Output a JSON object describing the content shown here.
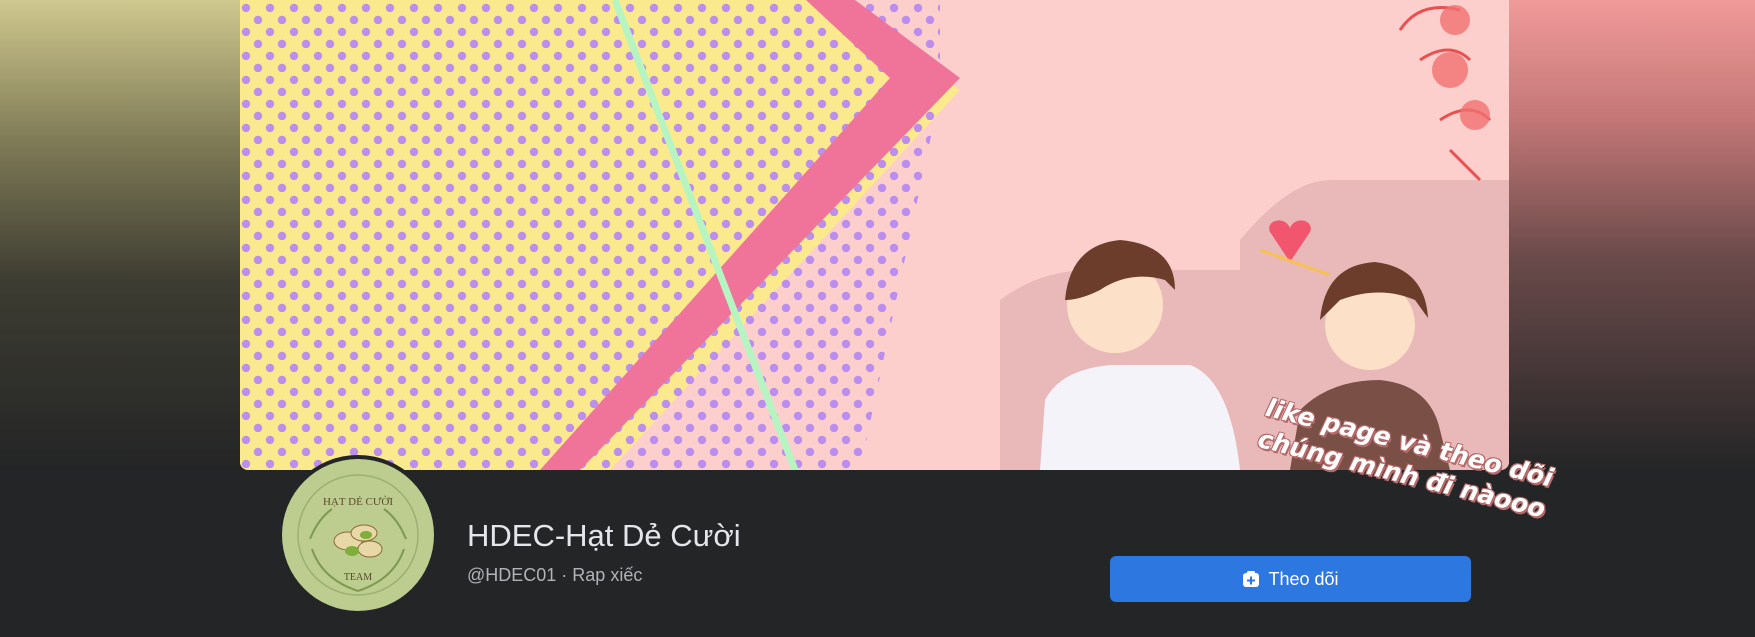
{
  "cover": {
    "caption_line1": "like page và theo dõi",
    "caption_line2": "chúng mình đi nàooo"
  },
  "avatar": {
    "text_top": "HẠT DẺ CƯỜI",
    "text_bottom": "TEAM"
  },
  "page": {
    "name": "HDEC-Hạt Dẻ Cười",
    "meta": "@HDEC01 · Rap xiếc"
  },
  "actions": {
    "follow_label": "Theo dõi",
    "follow_icon": "follow-plus-icon"
  },
  "colors": {
    "background": "#242526",
    "follow_button": "#2d77e0",
    "cover_pink": "#fccfcd",
    "cover_yellow": "#fbe98d",
    "dots": "#b88af0"
  }
}
